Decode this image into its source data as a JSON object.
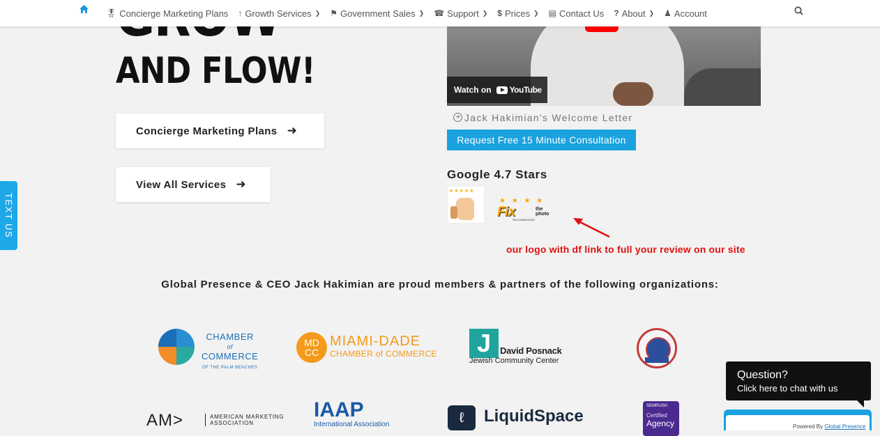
{
  "nav": {
    "home_icon": "home-icon",
    "items": [
      {
        "label": "Concierge Marketing Plans",
        "icon": "medal-icon",
        "dropdown": false
      },
      {
        "label": "Growth Services",
        "icon": "arrow-up-icon",
        "dropdown": true
      },
      {
        "label": "Government Sales",
        "icon": "flag-icon",
        "dropdown": true
      },
      {
        "label": "Support",
        "icon": "headset-icon",
        "dropdown": true
      },
      {
        "label": "Prices",
        "icon": "dollar-icon",
        "dropdown": true
      },
      {
        "label": "Contact Us",
        "icon": "address-card-icon",
        "dropdown": false
      },
      {
        "label": "About",
        "icon": "question-icon",
        "dropdown": true
      },
      {
        "label": "Account",
        "icon": "user-icon",
        "dropdown": true
      }
    ],
    "search_icon": "search-icon"
  },
  "hero": {
    "line1": "GROW",
    "line2": "AND FLOW!",
    "buttons": [
      {
        "label": "Concierge Marketing Plans"
      },
      {
        "label": "View All Services"
      }
    ]
  },
  "video": {
    "watch_label": "Watch on",
    "youtube_label": "YouTube",
    "welcome_link": "Jack Hakimian's Welcome Letter",
    "consult_button": "Request Free 15 Minute Consultation"
  },
  "reviews": {
    "google_rating": "Google 4.7 Stars",
    "fix_stars": "★ ★ ★ ★ ★",
    "fix_word": "Fix",
    "fix_the": "the",
    "fix_photo": "photo",
    "fix_rec": "RECOMMENDED",
    "annotation": "our logo with df link to full your review on our site",
    "annotation_color": "#e01010"
  },
  "members": {
    "heading": "Global Presence & CEO Jack Hakimian are proud members & partners of the following organizations:",
    "logos": {
      "chamber_l1": "CHAMBER",
      "chamber_l2": "of",
      "chamber_l3": "COMMERCE",
      "chamber_l4": "OF THE PALM BEACHES",
      "md_circle_l1": "MD",
      "md_circle_l2": "CC",
      "md_text": "MIAMI-DADE",
      "md_sub": "CHAMBER of COMMERCE",
      "j_letter": "J",
      "j_text": "David Posnack",
      "j_sub": "Jewish Community Center",
      "ama_text": "AM>",
      "ama_l1": "AMERICAN MARKETING",
      "ama_l2": "ASSOCIATION",
      "iaap_text": "IAAP",
      "iaap_sub": "International Association",
      "lq_text": "LiquidSpace",
      "sem_top": "SEMRUSH",
      "sem_cert": "Certified",
      "sem_agency": "Agency"
    }
  },
  "widgets": {
    "text_us": "TEXT US",
    "chat_question": "Question?",
    "chat_sub": "Click here to chat with us",
    "powered_prefix": "Powered By",
    "powered_by": "Global Presence"
  },
  "colors": {
    "accent": "#1ba2e0",
    "nav_home": "#1a9ad6"
  }
}
